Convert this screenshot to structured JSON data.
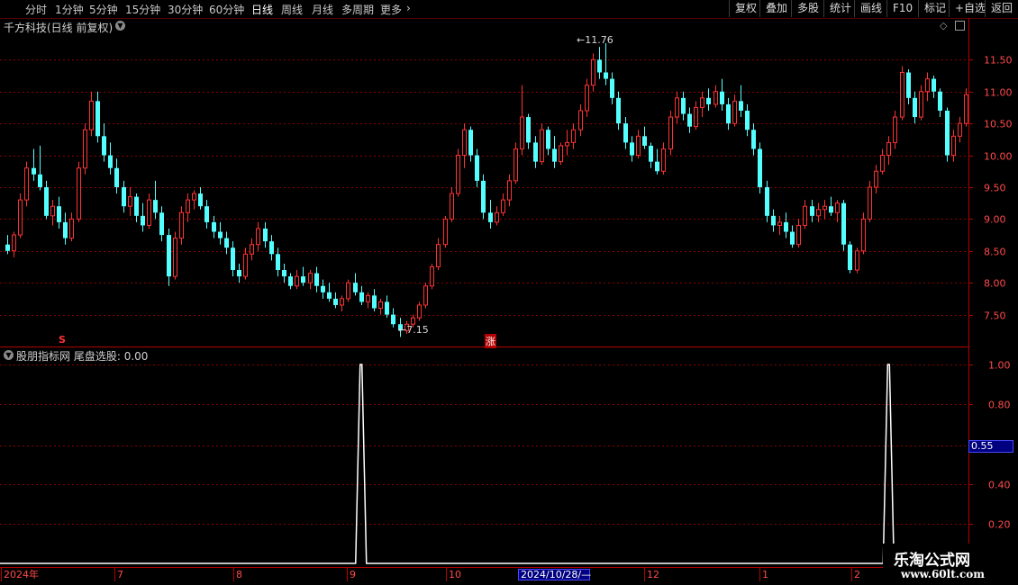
{
  "toolbar": {
    "periods": [
      "分时",
      "1分钟",
      "5分钟",
      "15分钟",
      "30分钟",
      "60分钟",
      "日线",
      "周线",
      "月线",
      "多周期",
      "更多"
    ],
    "active_period": "日线",
    "more_chevron": "chevron-right-icon",
    "right_buttons": [
      "复权",
      "叠加",
      "多股",
      "统计",
      "画线",
      "F10",
      "标记",
      "+自选",
      "返回"
    ]
  },
  "stock_header": {
    "title": "千方科技(日线 前复权)",
    "toggle_icon": "chevron-down-icon"
  },
  "price_chart": {
    "y_ticks": [
      "11.50",
      "11.00",
      "10.50",
      "10.00",
      "9.50",
      "9.00",
      "8.50",
      "8.00",
      "7.50"
    ],
    "high_label": "11.76",
    "low_label": "7.15",
    "marker_s": "S",
    "marker_zhang": "涨",
    "colors": {
      "up": "#ff3232",
      "down": "#54ffff",
      "grid": "#8b0000",
      "axis": "#b40000"
    }
  },
  "indicator": {
    "title": "股朋指标网",
    "series_label": "尾盘选股:",
    "series_value": "0.00",
    "y_ticks": [
      "1.00",
      "0.80",
      "0.40",
      "0.20"
    ],
    "cursor_value": "0.55",
    "line_color": "#ffffff"
  },
  "time_axis": {
    "labels": [
      "2024年",
      "7",
      "8",
      "9",
      "10",
      "12",
      "1",
      "2"
    ],
    "highlight": "2024/10/28/—"
  },
  "watermark": {
    "line1": "乐淘公式网",
    "line2": "www.60lt.com"
  },
  "chart_data": {
    "type": "candlestick",
    "title": "千方科技(日线 前复权)",
    "ylim": [
      7.0,
      11.9
    ],
    "y_ticks": [
      7.5,
      8.0,
      8.5,
      9.0,
      9.5,
      10.0,
      10.5,
      11.0,
      11.5
    ],
    "x_labels": [
      "2024年",
      "7",
      "8",
      "9",
      "10",
      "12",
      "1",
      "2"
    ],
    "series": [
      {
        "name": "price",
        "ohlc": [
          [
            8.6,
            8.75,
            8.45,
            8.5
          ],
          [
            8.5,
            8.8,
            8.4,
            8.75
          ],
          [
            8.75,
            9.4,
            8.7,
            9.3
          ],
          [
            9.3,
            9.9,
            9.2,
            9.8
          ],
          [
            9.8,
            10.1,
            9.6,
            9.7
          ],
          [
            9.7,
            10.15,
            9.45,
            9.5
          ],
          [
            9.5,
            9.6,
            9.0,
            9.05
          ],
          [
            9.05,
            9.3,
            8.9,
            9.2
          ],
          [
            9.2,
            9.35,
            8.85,
            8.95
          ],
          [
            8.95,
            9.1,
            8.6,
            8.7
          ],
          [
            8.7,
            9.1,
            8.65,
            9.0
          ],
          [
            9.0,
            9.9,
            8.95,
            9.8
          ],
          [
            9.8,
            10.5,
            9.7,
            10.4
          ],
          [
            10.4,
            11.0,
            10.3,
            10.85
          ],
          [
            10.85,
            11.0,
            10.2,
            10.3
          ],
          [
            10.3,
            10.5,
            9.9,
            10.0
          ],
          [
            10.0,
            10.2,
            9.7,
            9.8
          ],
          [
            9.8,
            9.95,
            9.4,
            9.5
          ],
          [
            9.5,
            9.6,
            9.1,
            9.2
          ],
          [
            9.2,
            9.5,
            9.05,
            9.35
          ],
          [
            9.35,
            9.4,
            8.95,
            9.05
          ],
          [
            9.05,
            9.25,
            8.8,
            8.9
          ],
          [
            8.9,
            9.4,
            8.85,
            9.3
          ],
          [
            9.3,
            9.6,
            9.0,
            9.1
          ],
          [
            9.1,
            9.2,
            8.65,
            8.75
          ],
          [
            8.75,
            8.85,
            7.95,
            8.1
          ],
          [
            8.1,
            8.8,
            8.05,
            8.7
          ],
          [
            8.7,
            9.2,
            8.6,
            9.1
          ],
          [
            9.1,
            9.4,
            8.95,
            9.3
          ],
          [
            9.3,
            9.45,
            9.15,
            9.4
          ],
          [
            9.4,
            9.5,
            9.15,
            9.2
          ],
          [
            9.2,
            9.3,
            8.85,
            8.95
          ],
          [
            8.95,
            9.05,
            8.7,
            8.8
          ],
          [
            8.8,
            8.95,
            8.6,
            8.7
          ],
          [
            8.7,
            8.8,
            8.45,
            8.55
          ],
          [
            8.55,
            8.65,
            8.1,
            8.2
          ],
          [
            8.2,
            8.3,
            8.0,
            8.1
          ],
          [
            8.1,
            8.55,
            8.05,
            8.45
          ],
          [
            8.45,
            8.7,
            8.35,
            8.6
          ],
          [
            8.6,
            8.95,
            8.5,
            8.85
          ],
          [
            8.85,
            8.95,
            8.55,
            8.65
          ],
          [
            8.65,
            8.75,
            8.35,
            8.45
          ],
          [
            8.45,
            8.55,
            8.1,
            8.2
          ],
          [
            8.2,
            8.3,
            8.0,
            8.1
          ],
          [
            8.1,
            8.15,
            7.9,
            7.95
          ],
          [
            7.95,
            8.2,
            7.9,
            8.1
          ],
          [
            8.1,
            8.25,
            7.95,
            8.0
          ],
          [
            8.0,
            8.2,
            7.9,
            8.15
          ],
          [
            8.15,
            8.25,
            7.85,
            7.95
          ],
          [
            7.95,
            8.05,
            7.75,
            7.85
          ],
          [
            7.85,
            8.0,
            7.7,
            7.75
          ],
          [
            7.75,
            7.85,
            7.6,
            7.65
          ],
          [
            7.65,
            7.8,
            7.55,
            7.75
          ],
          [
            7.75,
            8.05,
            7.7,
            8.0
          ],
          [
            8.0,
            8.15,
            7.8,
            7.85
          ],
          [
            7.85,
            7.95,
            7.65,
            7.7
          ],
          [
            7.7,
            7.85,
            7.6,
            7.8
          ],
          [
            7.8,
            7.9,
            7.55,
            7.6
          ],
          [
            7.6,
            7.75,
            7.5,
            7.7
          ],
          [
            7.7,
            7.8,
            7.45,
            7.5
          ],
          [
            7.5,
            7.6,
            7.3,
            7.35
          ],
          [
            7.35,
            7.45,
            7.15,
            7.25
          ],
          [
            7.25,
            7.4,
            7.2,
            7.35
          ],
          [
            7.35,
            7.5,
            7.3,
            7.45
          ],
          [
            7.45,
            7.7,
            7.4,
            7.65
          ],
          [
            7.65,
            8.0,
            7.6,
            7.95
          ],
          [
            7.95,
            8.3,
            7.9,
            8.25
          ],
          [
            8.25,
            8.7,
            8.2,
            8.6
          ],
          [
            8.6,
            9.05,
            8.55,
            9.0
          ],
          [
            9.0,
            9.5,
            8.95,
            9.4
          ],
          [
            9.4,
            10.1,
            9.35,
            10.0
          ],
          [
            10.0,
            10.5,
            9.8,
            10.4
          ],
          [
            10.4,
            10.45,
            9.9,
            10.0
          ],
          [
            10.0,
            10.1,
            9.5,
            9.6
          ],
          [
            9.6,
            9.7,
            9.0,
            9.1
          ],
          [
            9.1,
            9.3,
            8.85,
            8.95
          ],
          [
            8.95,
            9.2,
            8.9,
            9.1
          ],
          [
            9.1,
            9.4,
            9.05,
            9.3
          ],
          [
            9.3,
            9.7,
            9.2,
            9.6
          ],
          [
            9.6,
            10.2,
            9.55,
            10.1
          ],
          [
            10.1,
            11.1,
            10.0,
            10.6
          ],
          [
            10.6,
            10.65,
            10.1,
            10.2
          ],
          [
            10.2,
            10.3,
            9.8,
            9.9
          ],
          [
            9.9,
            10.5,
            9.85,
            10.4
          ],
          [
            10.4,
            10.45,
            10.0,
            10.1
          ],
          [
            10.1,
            10.3,
            9.8,
            9.9
          ],
          [
            9.9,
            10.2,
            9.85,
            10.15
          ],
          [
            10.15,
            10.4,
            10.0,
            10.2
          ],
          [
            10.2,
            10.5,
            10.1,
            10.4
          ],
          [
            10.4,
            10.8,
            10.3,
            10.7
          ],
          [
            10.7,
            11.2,
            10.6,
            11.1
          ],
          [
            11.1,
            11.6,
            11.0,
            11.5
          ],
          [
            11.5,
            11.7,
            11.2,
            11.3
          ],
          [
            11.3,
            11.76,
            11.1,
            11.2
          ],
          [
            11.2,
            11.3,
            10.8,
            10.9
          ],
          [
            10.9,
            11.0,
            10.4,
            10.5
          ],
          [
            10.5,
            10.6,
            10.1,
            10.2
          ],
          [
            10.2,
            10.3,
            9.9,
            10.0
          ],
          [
            10.0,
            10.4,
            9.95,
            10.3
          ],
          [
            10.3,
            10.45,
            10.1,
            10.15
          ],
          [
            10.15,
            10.2,
            9.8,
            9.9
          ],
          [
            9.9,
            10.1,
            9.7,
            9.75
          ],
          [
            9.75,
            10.2,
            9.7,
            10.1
          ],
          [
            10.1,
            10.7,
            10.0,
            10.6
          ],
          [
            10.6,
            11.0,
            10.5,
            10.9
          ],
          [
            10.9,
            11.0,
            10.55,
            10.65
          ],
          [
            10.65,
            10.75,
            10.35,
            10.45
          ],
          [
            10.45,
            10.85,
            10.4,
            10.75
          ],
          [
            10.75,
            11.0,
            10.6,
            10.9
          ],
          [
            10.9,
            11.05,
            10.7,
            10.8
          ],
          [
            10.8,
            11.1,
            10.75,
            11.0
          ],
          [
            11.0,
            11.2,
            10.7,
            10.8
          ],
          [
            10.8,
            10.9,
            10.4,
            10.5
          ],
          [
            10.5,
            10.95,
            10.45,
            10.85
          ],
          [
            10.85,
            11.1,
            10.6,
            10.7
          ],
          [
            10.7,
            10.8,
            10.3,
            10.4
          ],
          [
            10.4,
            10.5,
            10.0,
            10.1
          ],
          [
            10.1,
            10.2,
            9.4,
            9.5
          ],
          [
            9.5,
            9.6,
            8.95,
            9.05
          ],
          [
            9.05,
            9.15,
            8.8,
            8.9
          ],
          [
            8.9,
            9.05,
            8.75,
            8.95
          ],
          [
            8.95,
            9.1,
            8.7,
            8.8
          ],
          [
            8.8,
            8.9,
            8.55,
            8.6
          ],
          [
            8.6,
            9.0,
            8.55,
            8.9
          ],
          [
            8.9,
            9.3,
            8.85,
            9.2
          ],
          [
            9.2,
            9.3,
            8.95,
            9.05
          ],
          [
            9.05,
            9.25,
            8.95,
            9.15
          ],
          [
            9.15,
            9.3,
            9.0,
            9.2
          ],
          [
            9.2,
            9.35,
            9.05,
            9.1
          ],
          [
            9.1,
            9.3,
            8.95,
            9.25
          ],
          [
            9.25,
            9.3,
            8.5,
            8.6
          ],
          [
            8.6,
            8.65,
            8.15,
            8.2
          ],
          [
            8.2,
            8.55,
            8.15,
            8.5
          ],
          [
            8.5,
            9.1,
            8.45,
            9.0
          ],
          [
            9.0,
            9.6,
            8.95,
            9.5
          ],
          [
            9.5,
            9.85,
            9.4,
            9.75
          ],
          [
            9.75,
            10.1,
            9.7,
            10.0
          ],
          [
            10.0,
            10.3,
            9.85,
            10.2
          ],
          [
            10.2,
            10.7,
            10.1,
            10.6
          ],
          [
            10.6,
            11.4,
            10.55,
            11.3
          ],
          [
            11.3,
            11.35,
            10.8,
            10.9
          ],
          [
            10.9,
            11.0,
            10.5,
            10.6
          ],
          [
            10.6,
            11.1,
            10.55,
            11.0
          ],
          [
            11.0,
            11.3,
            10.85,
            11.2
          ],
          [
            11.2,
            11.25,
            10.9,
            11.0
          ],
          [
            11.0,
            11.05,
            10.6,
            10.7
          ],
          [
            10.7,
            10.75,
            9.9,
            10.0
          ],
          [
            10.0,
            10.4,
            9.9,
            10.3
          ],
          [
            10.3,
            10.6,
            10.2,
            10.5
          ],
          [
            10.5,
            11.05,
            10.45,
            10.95
          ]
        ]
      },
      {
        "name": "尾盘选股",
        "values_note": "0 everywhere except two spikes to 1.00",
        "spikes": [
          {
            "index": 55,
            "value": 1.0
          },
          {
            "index": 137,
            "value": 1.0
          }
        ],
        "ylim": [
          0,
          1.0
        ]
      }
    ]
  }
}
